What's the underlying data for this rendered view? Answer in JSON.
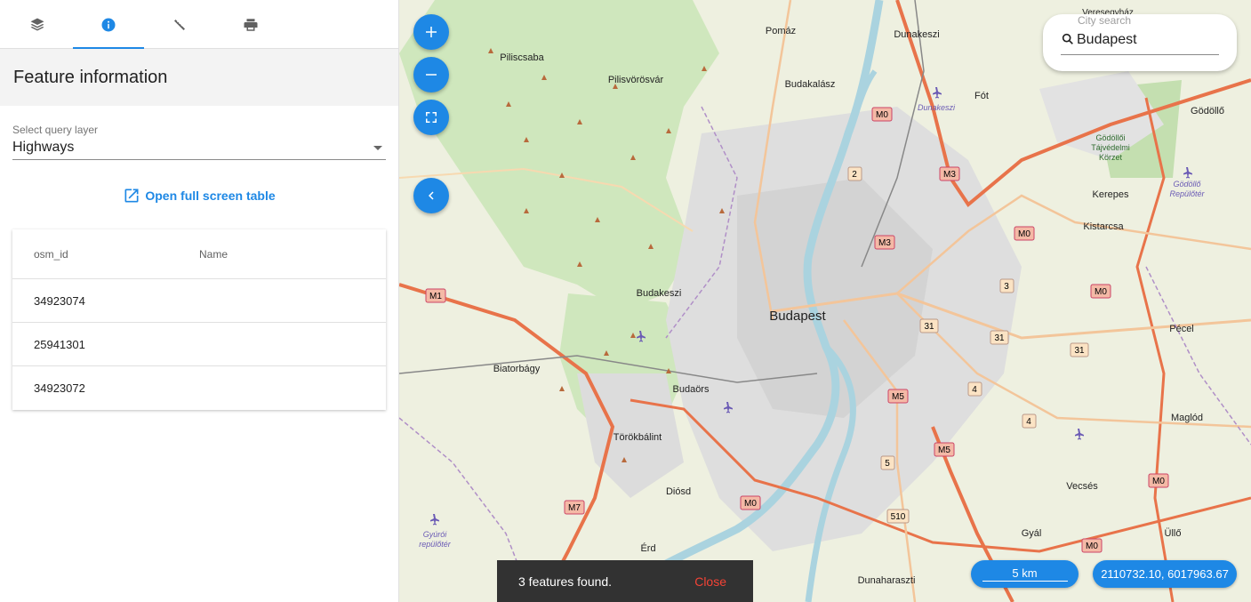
{
  "sidebar": {
    "tabs": [
      {
        "icon": "layers-icon",
        "active": false
      },
      {
        "icon": "info-icon",
        "active": true
      },
      {
        "icon": "ruler-icon",
        "active": false
      },
      {
        "icon": "print-icon",
        "active": false
      }
    ],
    "title": "Feature information",
    "query_layer": {
      "label": "Select query layer",
      "value": "Highways"
    },
    "open_table_label": "Open full screen table",
    "table": {
      "headers": [
        "osm_id",
        "Name"
      ],
      "rows": [
        {
          "osm_id": "34923074",
          "name": ""
        },
        {
          "osm_id": "25941301",
          "name": ""
        },
        {
          "osm_id": "34923072",
          "name": ""
        }
      ]
    }
  },
  "map": {
    "search": {
      "label": "City search",
      "value": "Budapest"
    },
    "scale_label": "5 km",
    "coordinates": "2110732.10, 6017963.67",
    "snackbar": {
      "message": "3 features found.",
      "action": "Close"
    },
    "places": {
      "budapest": "Budapest",
      "pomaz": "Pomáz",
      "piliscsaba": "Piliscsaba",
      "pilisvorosvar": "Pilisvörösvár",
      "budakalasz": "Budakalász",
      "dunakeszi": "Dunakeszi",
      "fot": "Fót",
      "godollo": "Gödöllő",
      "kerepes": "Kerepes",
      "kistarcsa": "Kistarcsa",
      "budakeszi": "Budakeszi",
      "biatorbagy": "Biatorbágy",
      "budaors": "Budaörs",
      "torokbalint": "Törökbálint",
      "diosd": "Diósd",
      "erd": "Érd",
      "pecel": "Pécel",
      "maglod": "Maglód",
      "vecses": "Vecsés",
      "gyal": "Gyál",
      "ullo": "Üllő",
      "dunaharaszti": "Dunaharaszti",
      "veresegyhaz": "Veresegyház"
    },
    "poi": {
      "dunakeszi_airport": "Dunakeszi",
      "godollo_park_1": "Gödöllői",
      "godollo_park_2": "Tájvédelmi",
      "godollo_park_3": "Körzet",
      "godollo_airport_1": "Gödöllő",
      "godollo_airport_2": "Repülőtér",
      "gyori_1": "Gyúrói",
      "gyori_2": "repülőtér"
    },
    "shields": [
      "M0",
      "M3",
      "M1",
      "M5",
      "M7",
      "2",
      "3",
      "4",
      "5",
      "31",
      "510"
    ],
    "colors": {
      "accent": "#1e88e5",
      "water": "#aad3df",
      "motorway": "#e8734a",
      "urban": "#d9d9d9"
    }
  }
}
